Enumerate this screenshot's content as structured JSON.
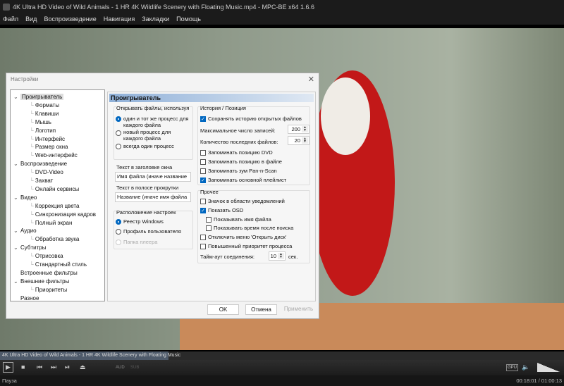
{
  "window": {
    "title": "4K Ultra HD Video of Wild Animals - 1 HR 4K Wildlife Scenery with Floating Music.mp4 - MPC-BE x64 1.6.6"
  },
  "menu": [
    "Файл",
    "Вид",
    "Воспроизведение",
    "Навигация",
    "Закладки",
    "Помощь"
  ],
  "dialog": {
    "title": "Настройки",
    "tree": [
      {
        "label": "Проигрыватель",
        "level": 0,
        "selected": true
      },
      {
        "label": "Форматы",
        "level": 1
      },
      {
        "label": "Клавиши",
        "level": 1
      },
      {
        "label": "Мышь",
        "level": 1
      },
      {
        "label": "Логотип",
        "level": 1
      },
      {
        "label": "Интерфейс",
        "level": 1
      },
      {
        "label": "Размер окна",
        "level": 1
      },
      {
        "label": "Web-интерфейс",
        "level": 1
      },
      {
        "label": "Воспроизведение",
        "level": 0
      },
      {
        "label": "DVD-Video",
        "level": 1
      },
      {
        "label": "Захват",
        "level": 1
      },
      {
        "label": "Онлайн сервисы",
        "level": 1
      },
      {
        "label": "Видео",
        "level": 0
      },
      {
        "label": "Коррекция цвета",
        "level": 1
      },
      {
        "label": "Синхронизация кадров",
        "level": 1
      },
      {
        "label": "Полный экран",
        "level": 1
      },
      {
        "label": "Аудио",
        "level": 0
      },
      {
        "label": "Обработка звука",
        "level": 1
      },
      {
        "label": "Субтитры",
        "level": 0
      },
      {
        "label": "Отрисовка",
        "level": 1
      },
      {
        "label": "Стандартный стиль",
        "level": 1
      },
      {
        "label": "Встроенные фильтры",
        "level": 0
      },
      {
        "label": "Внешние фильтры",
        "level": 0
      },
      {
        "label": "Приоритеты",
        "level": 1
      },
      {
        "label": "Разное",
        "level": 0
      }
    ],
    "panel_title": "Проигрыватель",
    "open_files": {
      "title": "Открывать файлы, используя",
      "options": [
        {
          "label": "один и тот же процесс для",
          "label2": "каждого файла",
          "checked": true
        },
        {
          "label": "новый процесс для",
          "label2": "каждого файла",
          "checked": false
        },
        {
          "label": "всегда один процесс",
          "label2": "",
          "checked": false
        }
      ]
    },
    "window_title_text": {
      "label": "Текст в заголовке окна",
      "value": "Имя файла (иначе название"
    },
    "scroll_text": {
      "label": "Текст в полосе прокрутки",
      "value": "Название (иначе имя файла"
    },
    "settings_location": {
      "title": "Расположение настроек",
      "options": [
        {
          "label": "Реестр Windows",
          "checked": true,
          "disabled": false
        },
        {
          "label": "Профиль пользователя",
          "checked": false,
          "disabled": false
        },
        {
          "label": "Папка плеера",
          "checked": false,
          "disabled": true
        }
      ]
    },
    "history": {
      "title": "История / Позиция",
      "save_history": {
        "label": "Сохранять историю открытых файлов",
        "checked": true
      },
      "max_entries": {
        "label": "Максимальное число записей:",
        "value": "200"
      },
      "recent_files": {
        "label": "Количество последних файлов:",
        "value": "20"
      },
      "checks": [
        {
          "label": "Запоминать позицию DVD",
          "checked": false
        },
        {
          "label": "Запоминать позицию в файле",
          "checked": false
        },
        {
          "label": "Запоминать зум Pan-n-Scan",
          "checked": false
        },
        {
          "label": "Запоминать основной плейлист",
          "checked": true
        }
      ]
    },
    "misc": {
      "title": "Прочее",
      "checks": [
        {
          "label": "Значок в области уведомлений",
          "checked": false,
          "indent": 0
        },
        {
          "label": "Показать OSD",
          "checked": true,
          "indent": 0
        },
        {
          "label": "Показывать имя файла",
          "checked": false,
          "indent": 1
        },
        {
          "label": "Показывать время после поиска",
          "checked": false,
          "indent": 1
        },
        {
          "label": "Отключить меню 'Открыть диск'",
          "checked": false,
          "indent": 0
        },
        {
          "label": "Повышенный приоритет процесса",
          "checked": false,
          "indent": 0
        }
      ],
      "timeout": {
        "label": "Тайм-аут соединения:",
        "value": "10",
        "unit": "сек."
      }
    },
    "buttons": {
      "ok": "OK",
      "cancel": "Отмена",
      "apply": "Применить"
    }
  },
  "player": {
    "seek_text": "4K Ultra HD Video of Wild Animals - 1 HR 4K Wildlife Scenery with Floating Music",
    "progress": 0.299,
    "aud": "AUD",
    "sub": "SUB",
    "gpu": "GPU",
    "status": "Пауза",
    "time": "00:18:01 / 01:00:13",
    "volume": 1.0
  }
}
